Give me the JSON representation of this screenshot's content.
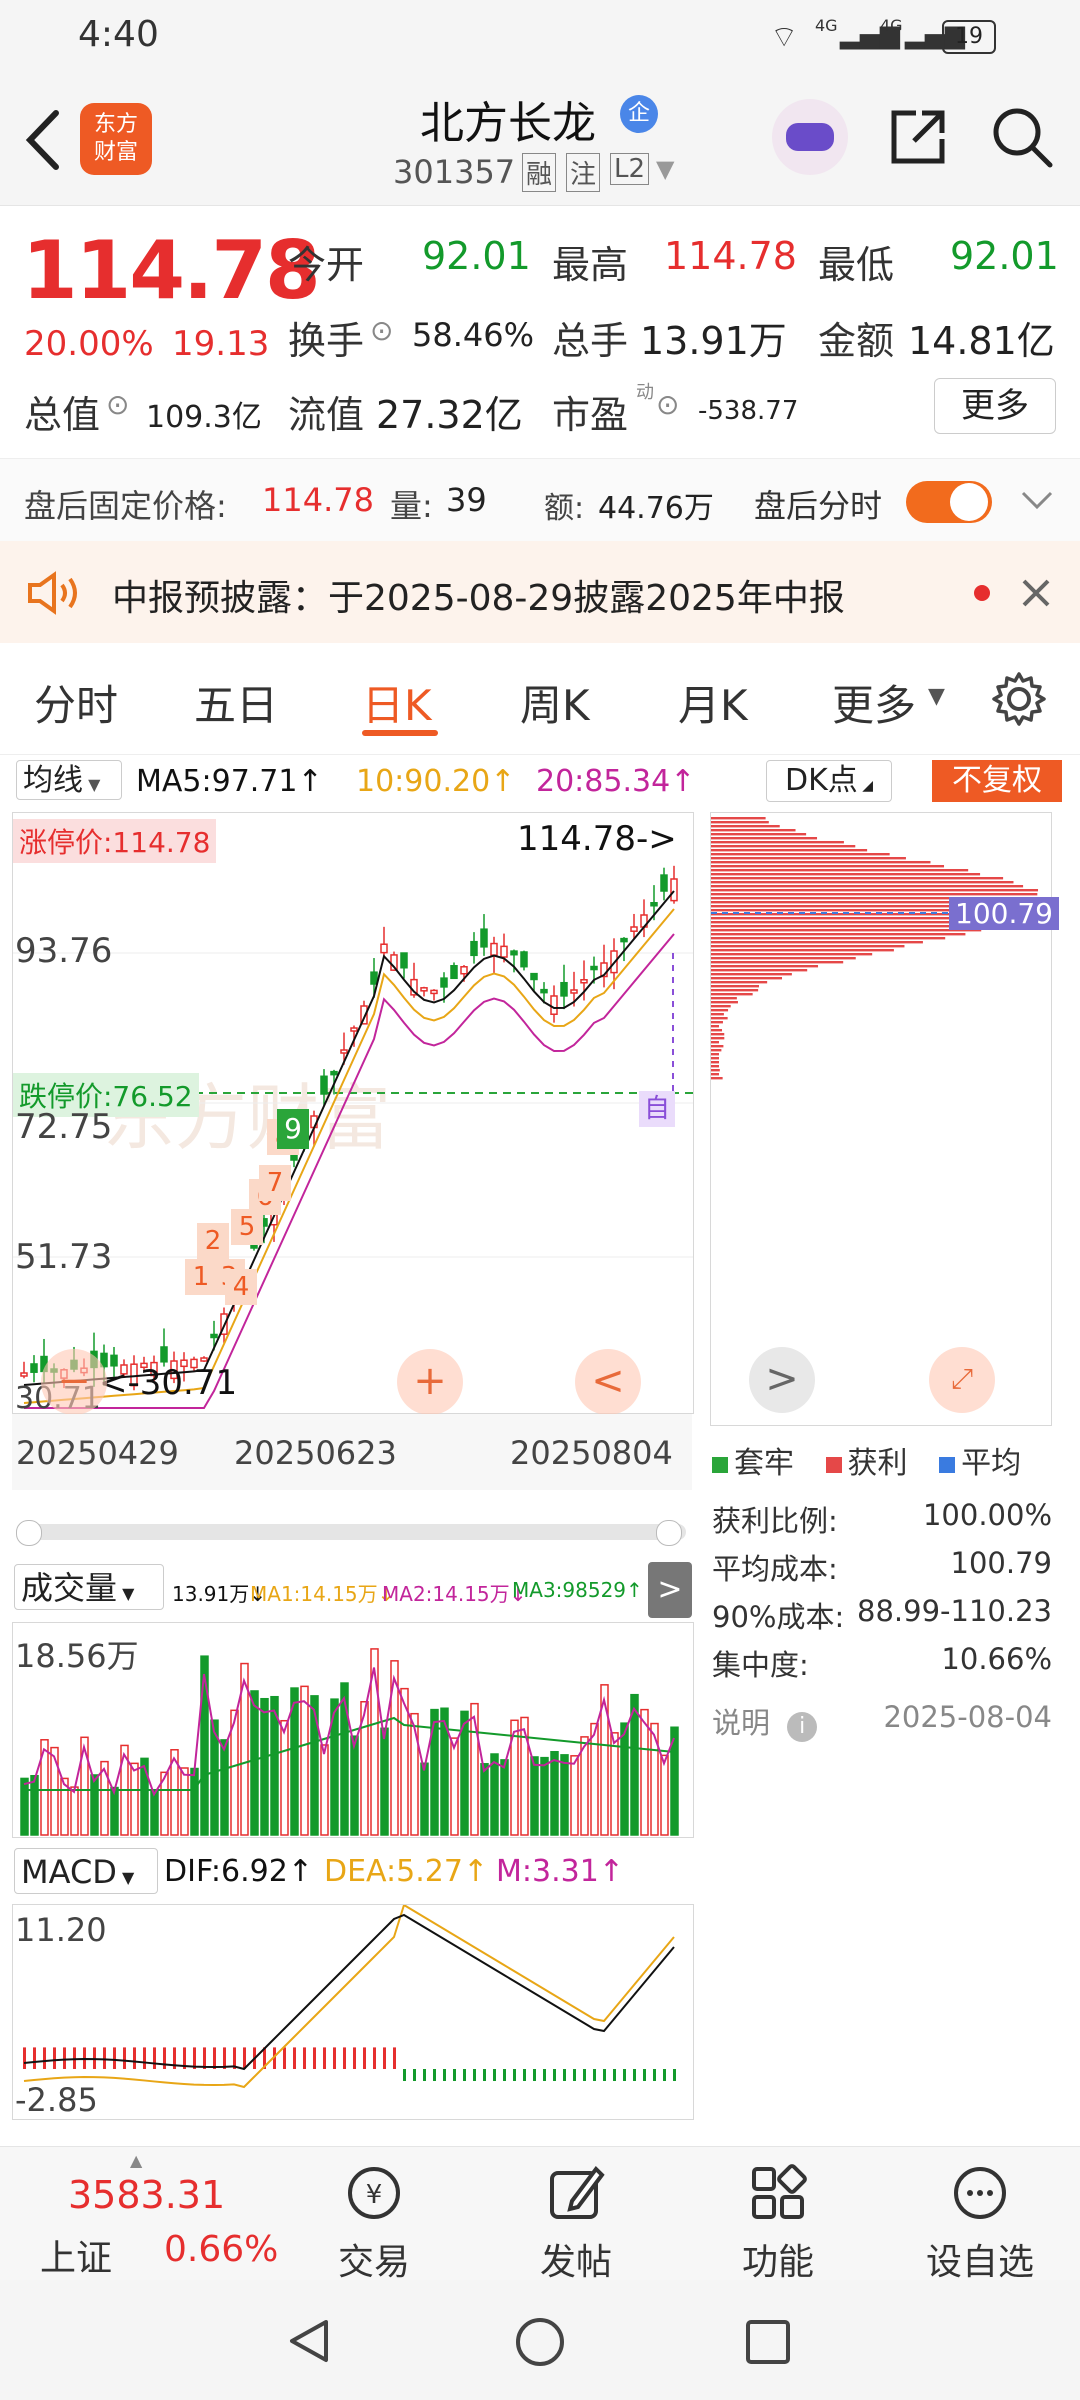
{
  "status_bar": {
    "time": "4:40",
    "net1": "4G",
    "net2": "4G",
    "battery": "19"
  },
  "header": {
    "title": "北方长龙",
    "badge": "企",
    "code": "301357",
    "tag1": "融",
    "tag2": "注",
    "tag3": "L2",
    "logo_line1": "东方",
    "logo_line2": "财富"
  },
  "quote": {
    "price": "114.78",
    "change_pct": "20.00%",
    "change_amt": "19.13",
    "open_label": "今开",
    "open": "92.01",
    "high_label": "最高",
    "high": "114.78",
    "low_label": "最低",
    "low": "92.01",
    "turnover_label": "换手",
    "turnover": "58.46%",
    "volume_label": "总手",
    "volume": "13.91万",
    "amount_label": "金额",
    "amount": "14.81亿",
    "mktcap_label": "总值",
    "mktcap": "109.3亿",
    "float_label": "流值",
    "float": "27.32亿",
    "pe_label": "市盈",
    "pe_sup": "动",
    "pe": "-538.77",
    "more_button": "更多"
  },
  "after_hours": {
    "fixed_price_label": "盘后固定价格:",
    "fixed_price": "114.78",
    "qty_label": "量:",
    "qty": "39",
    "amount_label": "额:",
    "amount": "44.76万",
    "toggle_label": "盘后分时"
  },
  "notice": {
    "text": "中报预披露：于2025-08-29披露2025年中报"
  },
  "tabs": [
    "分时",
    "五日",
    "日K",
    "周K",
    "月K",
    "更多"
  ],
  "active_tab": "日K",
  "ma_bar": {
    "type": "均线",
    "ma5": "MA5:97.71↑",
    "ma10": "10:90.20↑",
    "ma20": "20:85.34↑",
    "dk": "DK点",
    "fuquan": "不复权"
  },
  "kline": {
    "limit_up_label": "涨停价:114.78",
    "limit_down_label": "跌停价:76.52",
    "last_price_label": "114.78->",
    "y_labels": [
      "93.76",
      "72.75",
      "51.73",
      "30.71"
    ],
    "min_label": "30.71",
    "x_labels": [
      "20250429",
      "20250623",
      "20250804"
    ],
    "nine_marks": [
      "1",
      "2",
      "3",
      "4",
      "5",
      "6",
      "7",
      "8",
      "9"
    ],
    "auto_label": "自",
    "watermark": "东方财富"
  },
  "chip": {
    "avg_label": "100.79",
    "legend": [
      "套牢",
      "获利",
      "平均"
    ],
    "legend_colors": [
      "#2aa53a",
      "#e54848",
      "#3a7be0"
    ],
    "stats": [
      {
        "label": "获利比例:",
        "value": "100.00%"
      },
      {
        "label": "平均成本:",
        "value": "100.79"
      },
      {
        "label": "90%成本:",
        "value": "88.99-110.23"
      },
      {
        "label": "集中度:",
        "value": "10.66%"
      }
    ],
    "note_label": "说明",
    "date": "2025-08-04"
  },
  "volume_bar": {
    "type": "成交量",
    "v": "13.91万↓",
    "ma1": "MA1:14.15万↓",
    "ma2": "MA2:14.15万↓",
    "ma3": "MA3:98529↑",
    "max_label": "18.56万"
  },
  "macd_bar": {
    "type": "MACD",
    "dif": "DIF:6.92↑",
    "dea": "DEA:5.27↑",
    "m": "M:3.31↑",
    "top_label": "11.20",
    "bottom_label": "-2.85"
  },
  "bottom_nav": {
    "index_value": "3583.31",
    "index_name": "上证",
    "index_pct": "0.66%",
    "items": [
      "交易",
      "发帖",
      "功能",
      "设自选"
    ]
  }
}
